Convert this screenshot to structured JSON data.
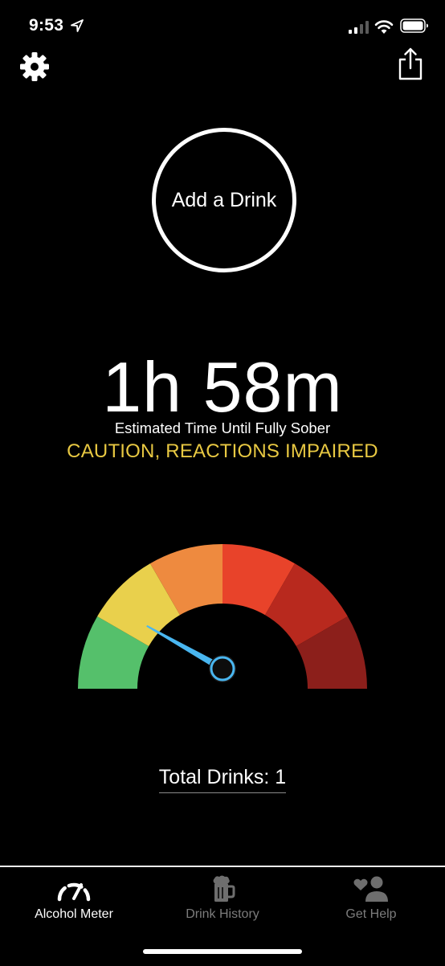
{
  "status_bar": {
    "time": "9:53",
    "icons": [
      "location-arrow-icon",
      "cellular-signal-icon",
      "wifi-icon",
      "battery-icon"
    ]
  },
  "header": {
    "settings_icon": "gear-icon",
    "share_icon": "share-icon"
  },
  "add_drink": {
    "label": "Add a Drink"
  },
  "sober": {
    "time": "1h 58m",
    "caption": "Estimated Time Until Fully Sober",
    "warning": "CAUTION, REACTIONS IMPAIRED",
    "warning_color": "#e8c842"
  },
  "gauge": {
    "segments": [
      {
        "color": "#55c06b"
      },
      {
        "color": "#e9d04c"
      },
      {
        "color": "#ee8a3f"
      },
      {
        "color": "#e8432a"
      },
      {
        "color": "#b8291e"
      },
      {
        "color": "#8c1f1b"
      }
    ],
    "needle_level": 0.19,
    "needle_color": "#49b6f0"
  },
  "total_drinks": {
    "label": "Total Drinks: 1"
  },
  "tabs": [
    {
      "label": "Alcohol Meter",
      "icon": "speedometer-icon",
      "active": true
    },
    {
      "label": "Drink History",
      "icon": "beer-mug-icon",
      "active": false
    },
    {
      "label": "Get Help",
      "icon": "person-heart-icon",
      "active": false
    }
  ]
}
